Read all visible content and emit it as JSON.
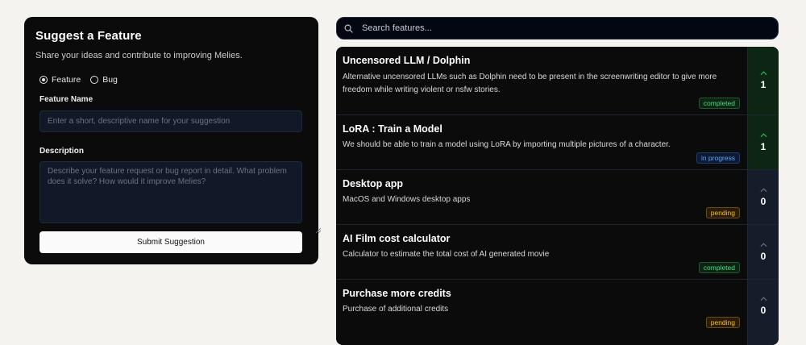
{
  "form": {
    "title": "Suggest a Feature",
    "subtitle": "Share your ideas and contribute to improving Melies.",
    "types": [
      {
        "label": "Feature",
        "selected": true
      },
      {
        "label": "Bug",
        "selected": false
      }
    ],
    "name_label": "Feature Name",
    "name_placeholder": "Enter a short, descriptive name for your suggestion",
    "desc_label": "Description",
    "desc_placeholder": "Describe your feature request or bug report in detail. What problem does it solve? How would it improve Melies?",
    "submit_label": "Submit Suggestion"
  },
  "search": {
    "placeholder": "Search features..."
  },
  "features": [
    {
      "title": "Uncensored LLM / Dolphin",
      "description": "Alternative uncensored LLMs such as Dolphin need to be present in the screenwriting editor to give more freedom while writing violent or nsfw stories.",
      "status": "completed",
      "votes": "1",
      "voted": true
    },
    {
      "title": "LoRA : Train a Model",
      "description": "We should be able to train a model using LoRA by importing multiple pictures of a character.",
      "status": "in progress",
      "votes": "1",
      "voted": true
    },
    {
      "title": "Desktop app",
      "description": "MacOS and Windows desktop apps",
      "status": "pending",
      "votes": "0",
      "voted": false
    },
    {
      "title": "AI Film cost calculator",
      "description": "Calculator to estimate the total cost of AI generated movie",
      "status": "completed",
      "votes": "0",
      "voted": false
    },
    {
      "title": "Purchase more credits",
      "description": "Purchase of additional credits",
      "status": "pending",
      "votes": "0",
      "voted": false
    }
  ],
  "colors": {
    "completed": "#4ade80",
    "in_progress": "#60a5fa",
    "pending": "#fbbf24",
    "panel_bg": "#0b0b0c",
    "page_bg": "#f5f3ef"
  }
}
